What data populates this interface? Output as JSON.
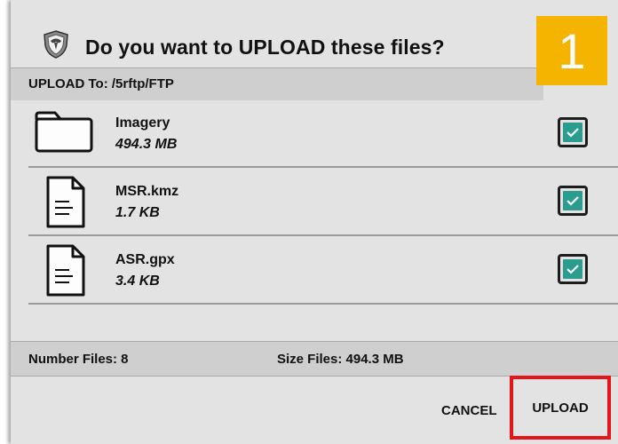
{
  "dialog": {
    "title": "Do you want to UPLOAD these files?",
    "logo_icon": "shield-logo-icon",
    "step_badge": "1"
  },
  "destination": {
    "label": "UPLOAD To: /5rftp/FTP"
  },
  "files": [
    {
      "name": "Imagery",
      "size": "494.3 MB",
      "icon": "folder-icon",
      "checked": true
    },
    {
      "name": "MSR.kmz",
      "size": "1.7 KB",
      "icon": "document-icon",
      "checked": true
    },
    {
      "name": "ASR.gpx",
      "size": "3.4 KB",
      "icon": "document-icon",
      "checked": true
    }
  ],
  "summary": {
    "count": "Number Files: 8",
    "size": "Size Files: 494.3 MB"
  },
  "actions": {
    "cancel_label": "CANCEL",
    "upload_label": "UPLOAD"
  },
  "colors": {
    "checkbox_fill": "#2a9d8f",
    "badge": "#f4b400",
    "highlight": "#e8141c"
  }
}
